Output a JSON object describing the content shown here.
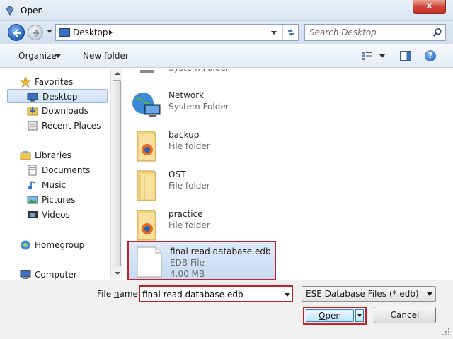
{
  "window": {
    "title": "Open",
    "close_glyph": "x"
  },
  "address": {
    "location": "Desktop",
    "search_placeholder": "Search Desktop"
  },
  "toolbar": {
    "organize_label": "Organize",
    "new_folder_label": "New folder",
    "help_glyph": "?"
  },
  "nav": {
    "items": [
      {
        "label": "Favorites",
        "icon": "star-icon",
        "selected": false
      },
      {
        "label": "Desktop",
        "icon": "desktop-icon",
        "selected": true
      },
      {
        "label": "Downloads",
        "icon": "downloads-icon",
        "selected": false
      },
      {
        "label": "Recent Places",
        "icon": "recent-places-icon",
        "selected": false
      },
      {
        "label": "Libraries",
        "icon": "libraries-icon",
        "selected": false
      },
      {
        "label": "Documents",
        "icon": "documents-icon",
        "selected": false
      },
      {
        "label": "Music",
        "icon": "music-icon",
        "selected": false
      },
      {
        "label": "Pictures",
        "icon": "pictures-icon",
        "selected": false
      },
      {
        "label": "Videos",
        "icon": "videos-icon",
        "selected": false
      },
      {
        "label": "Homegroup",
        "icon": "homegroup-icon",
        "selected": false
      },
      {
        "label": "Computer",
        "icon": "computer-icon",
        "selected": false
      }
    ]
  },
  "files": [
    {
      "name": "",
      "type": "System Folder",
      "size": "",
      "icon": "computer-icon",
      "selected": false
    },
    {
      "name": "Network",
      "type": "System Folder",
      "size": "",
      "icon": "network-icon",
      "selected": false
    },
    {
      "name": "backup",
      "type": "File folder",
      "size": "",
      "icon": "folder-icon",
      "selected": false
    },
    {
      "name": "OST",
      "type": "File folder",
      "size": "",
      "icon": "folder-icon",
      "selected": false
    },
    {
      "name": "practice",
      "type": "File folder",
      "size": "",
      "icon": "folder-icon",
      "selected": false
    },
    {
      "name": "final read database.edb",
      "type": "EDB File",
      "size": "4.00 MB",
      "icon": "file-icon",
      "selected": true
    }
  ],
  "bottom": {
    "file_name_label_pre": "File ",
    "file_name_label_accel": "n",
    "file_name_label_post": "ame:",
    "file_name_value": "final read database.edb",
    "filter_value": "ESE Database Files (*.edb)",
    "open_label_accel": "O",
    "open_label_rest": "pen",
    "cancel_label": "Cancel"
  },
  "colors": {
    "highlight_outline": "#c8202a",
    "selection": "#cfe0f6"
  }
}
